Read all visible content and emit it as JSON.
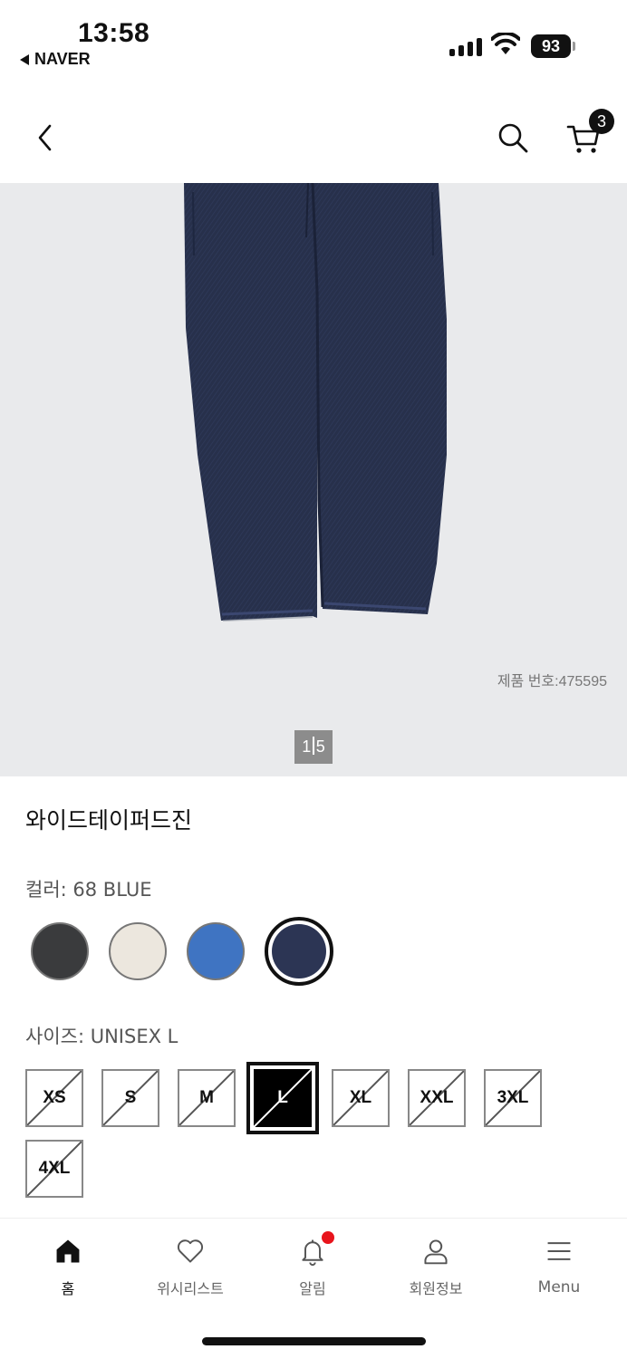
{
  "status_bar": {
    "time": "13:58",
    "back_app": "NAVER",
    "battery": "93"
  },
  "header": {
    "back_icon": "chevron-left-icon",
    "search_icon": "search-icon",
    "cart_icon": "cart-icon",
    "cart_count": "3"
  },
  "gallery": {
    "product_code": "제품 번호:475595",
    "pager_current": "1",
    "pager_total": "5",
    "background": "#e9eaec",
    "denim_color": "#2a3450"
  },
  "product": {
    "name": "와이드테이퍼드진",
    "color_label": "컬러: 68 BLUE",
    "colors": [
      {
        "hex": "#3a3b3d",
        "selected": false
      },
      {
        "hex": "#ece7de",
        "selected": false
      },
      {
        "hex": "#3f74c2",
        "selected": false
      },
      {
        "hex": "#2c3554",
        "selected": true
      }
    ],
    "size_label": "사이즈: UNISEX L",
    "sizes": [
      {
        "label": "XS",
        "selected": false,
        "unavailable": true
      },
      {
        "label": "S",
        "selected": false,
        "unavailable": true
      },
      {
        "label": "M",
        "selected": false,
        "unavailable": true
      },
      {
        "label": "L",
        "selected": true,
        "unavailable": true
      },
      {
        "label": "XL",
        "selected": false,
        "unavailable": true
      },
      {
        "label": "XXL",
        "selected": false,
        "unavailable": true
      },
      {
        "label": "3XL",
        "selected": false,
        "unavailable": true
      },
      {
        "label": "4XL",
        "selected": false,
        "unavailable": true
      }
    ]
  },
  "bottom_nav": {
    "items": [
      {
        "label": "홈",
        "icon": "home-icon",
        "active": true
      },
      {
        "label": "위시리스트",
        "icon": "heart-icon",
        "active": false
      },
      {
        "label": "알림",
        "icon": "bell-icon",
        "active": false
      },
      {
        "label": "회원정보",
        "icon": "user-icon",
        "active": false
      },
      {
        "label": "Menu",
        "icon": "menu-icon",
        "active": false
      }
    ]
  }
}
